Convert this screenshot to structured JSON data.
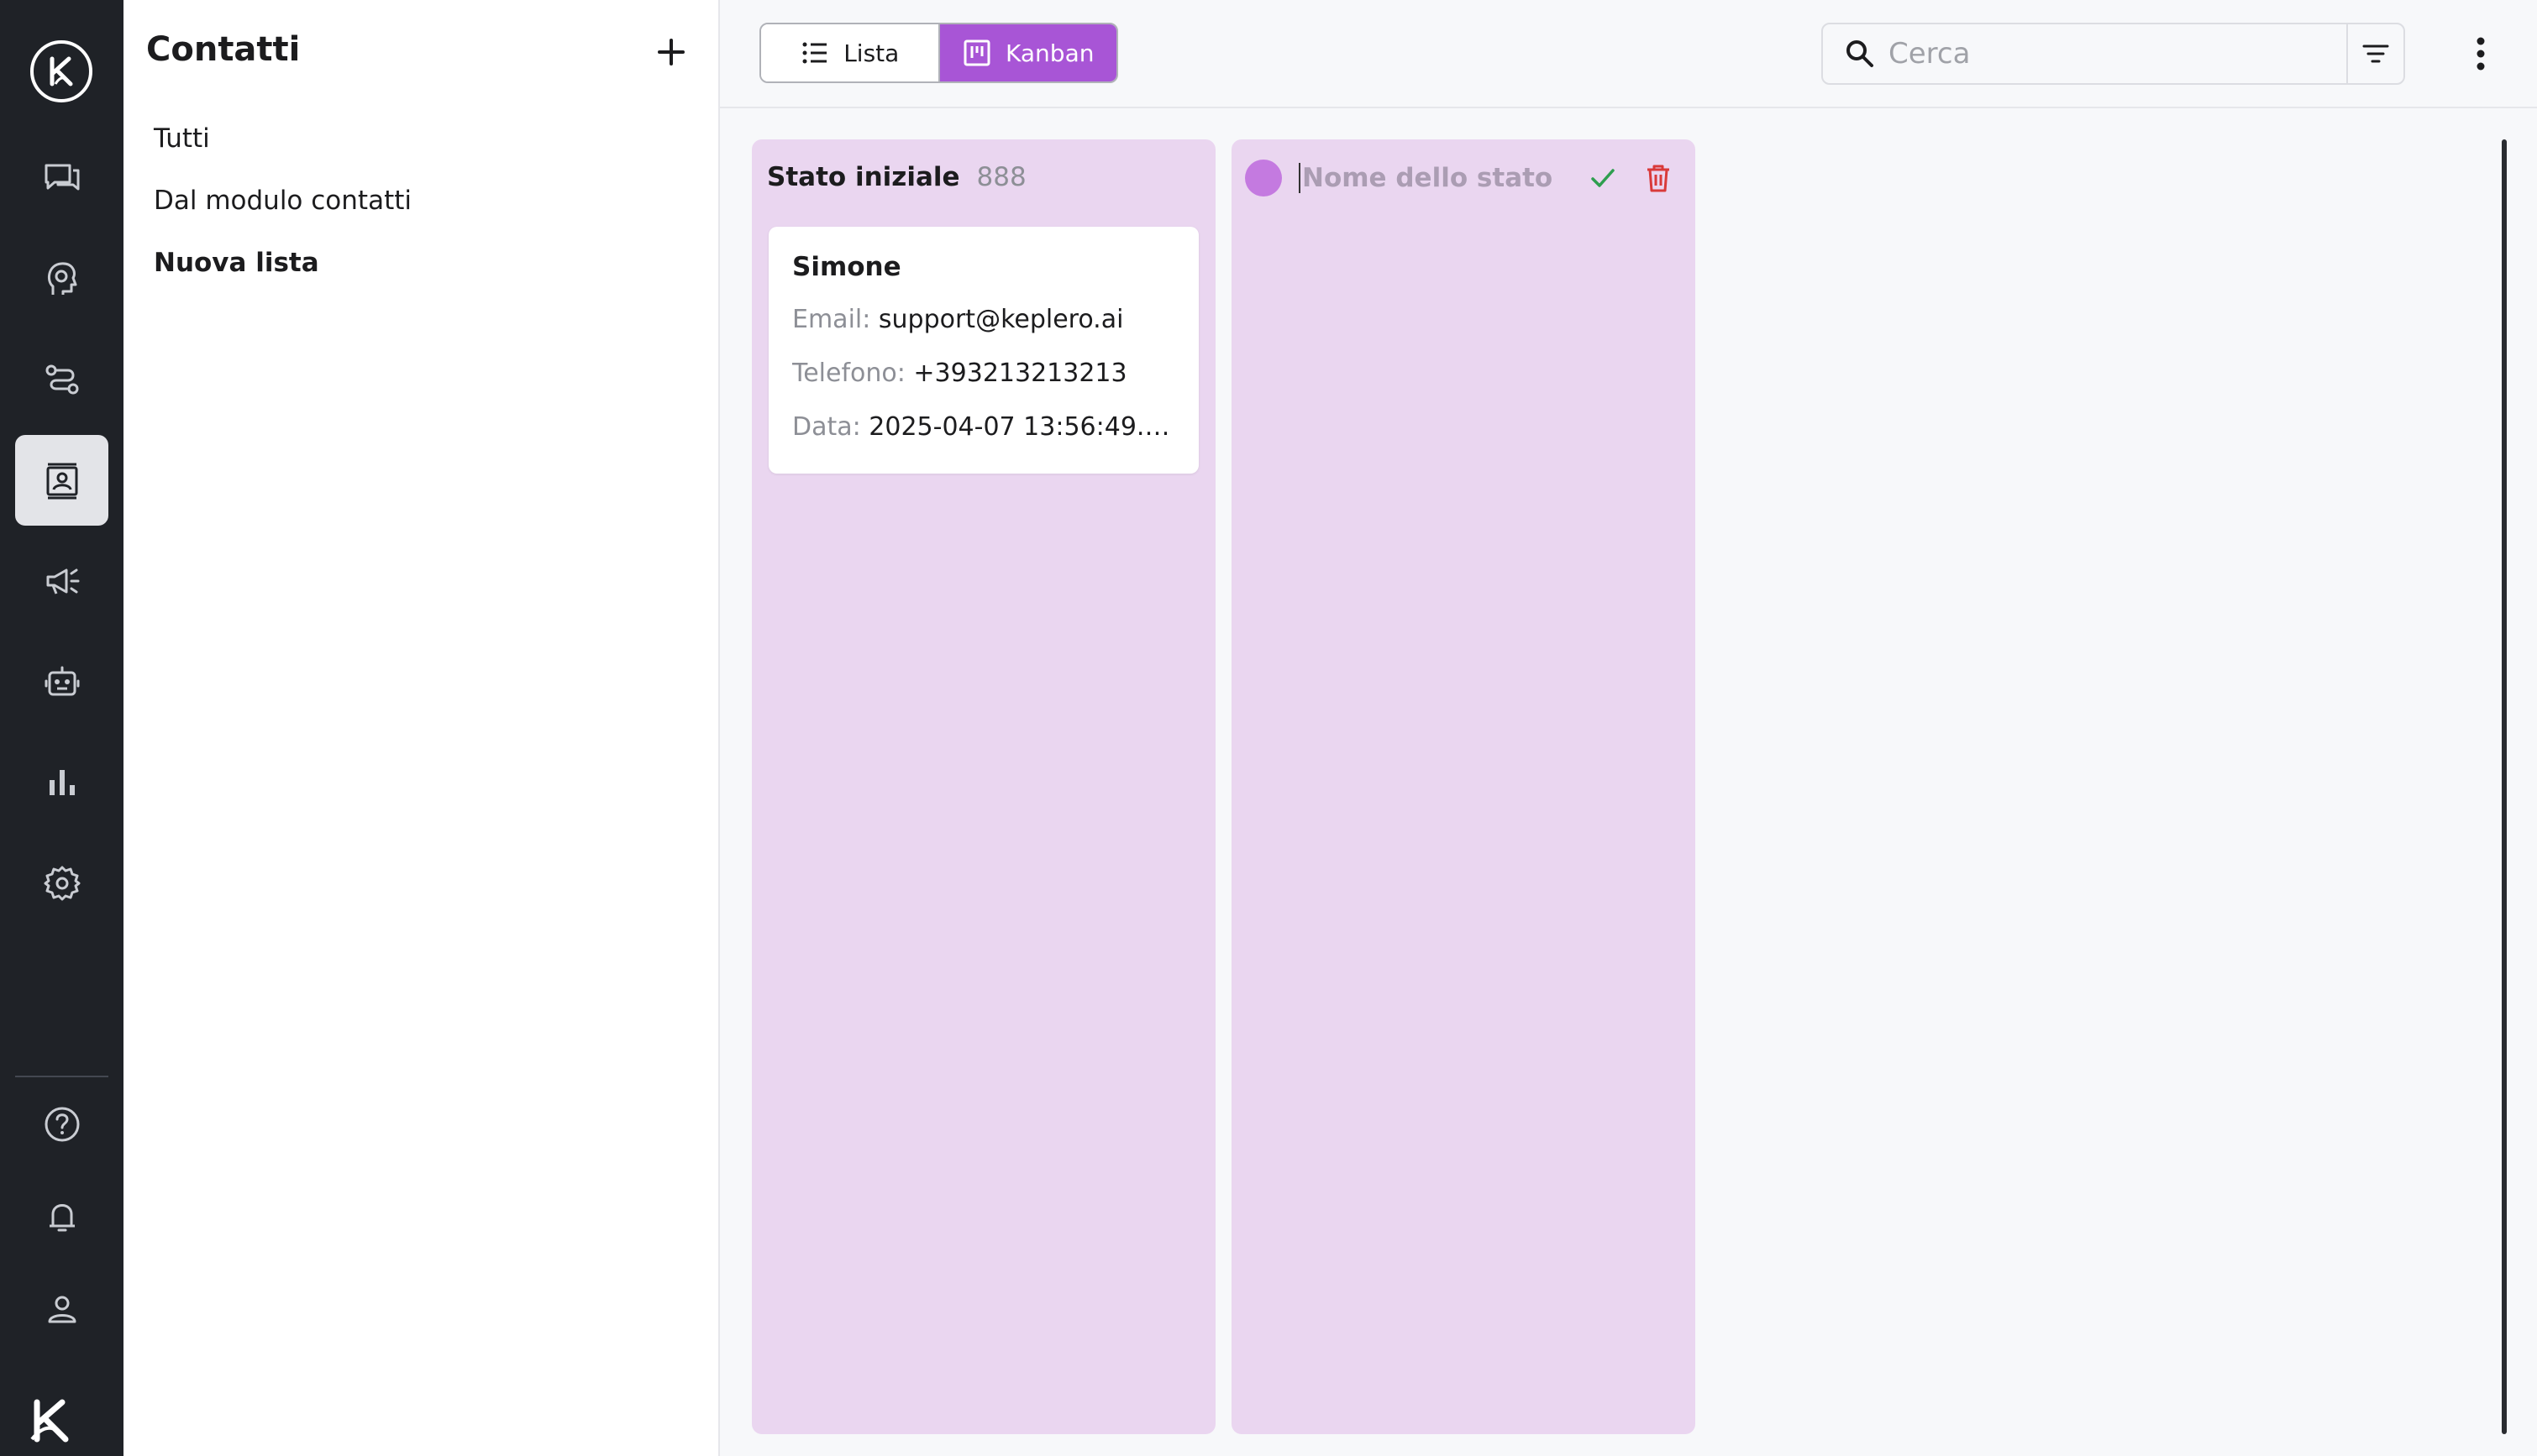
{
  "app": {
    "nav_icons": [
      "logo-icon",
      "chat-icon",
      "lightbulb-head-icon",
      "workflow-icon",
      "contacts-icon",
      "megaphone-icon",
      "robot-icon",
      "chart-icon",
      "settings-icon",
      "help-icon",
      "bell-icon",
      "user-icon",
      "brand-logo-icon"
    ],
    "accent_color": "#a855d6"
  },
  "lists_panel": {
    "title": "Contatti",
    "items": [
      {
        "label": "Tutti",
        "selected": false
      },
      {
        "label": "Dal modulo contatti",
        "selected": false
      },
      {
        "label": "Nuova lista",
        "selected": true
      }
    ]
  },
  "toolbar": {
    "view_list_label": "Lista",
    "view_kanban_label": "Kanban",
    "active_view": "Kanban",
    "search_placeholder": "Cerca",
    "search_value": ""
  },
  "board": {
    "columns": [
      {
        "name": "Stato iniziale",
        "count": "888",
        "cards": [
          {
            "name": "Simone",
            "email_label": "Email:",
            "email": "support@keplero.ai",
            "phone_label": "Telefono:",
            "phone": "+393213213213",
            "date_label": "Data:",
            "date": "2025-04-07 13:56:49.4..."
          }
        ]
      }
    ],
    "new_state": {
      "placeholder": "Nome dello stato",
      "value": "",
      "dot_color": "#c47ae0"
    }
  }
}
